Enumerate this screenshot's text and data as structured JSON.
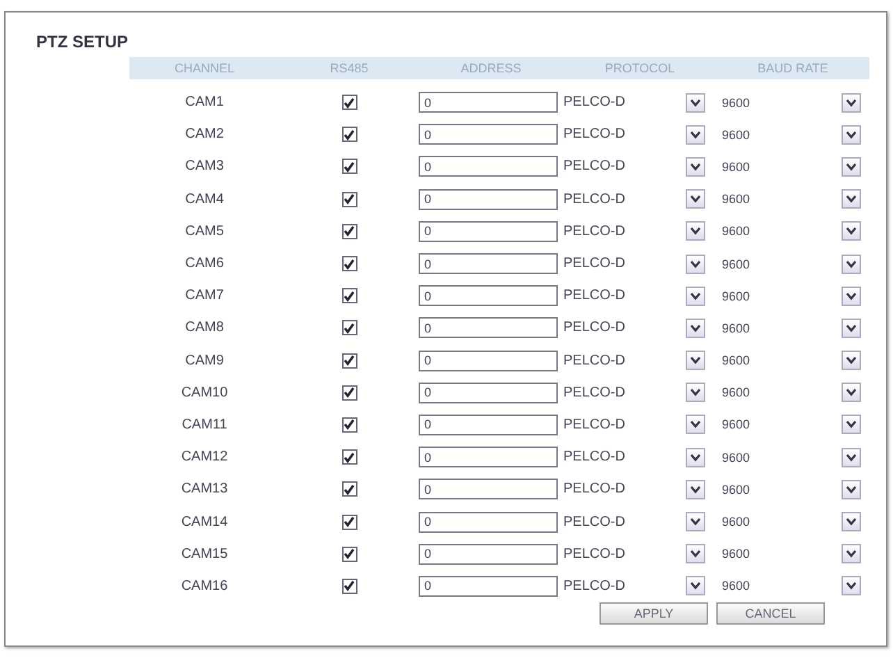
{
  "title": "PTZ SETUP",
  "columns": [
    "CHANNEL",
    "RS485",
    "ADDRESS",
    "PROTOCOL",
    "BAUD RATE"
  ],
  "rows": [
    {
      "channel": "CAM1",
      "rs485": true,
      "address": "0",
      "protocol": "PELCO-D",
      "baud_rate": "9600"
    },
    {
      "channel": "CAM2",
      "rs485": true,
      "address": "0",
      "protocol": "PELCO-D",
      "baud_rate": "9600"
    },
    {
      "channel": "CAM3",
      "rs485": true,
      "address": "0",
      "protocol": "PELCO-D",
      "baud_rate": "9600"
    },
    {
      "channel": "CAM4",
      "rs485": true,
      "address": "0",
      "protocol": "PELCO-D",
      "baud_rate": "9600"
    },
    {
      "channel": "CAM5",
      "rs485": true,
      "address": "0",
      "protocol": "PELCO-D",
      "baud_rate": "9600"
    },
    {
      "channel": "CAM6",
      "rs485": true,
      "address": "0",
      "protocol": "PELCO-D",
      "baud_rate": "9600"
    },
    {
      "channel": "CAM7",
      "rs485": true,
      "address": "0",
      "protocol": "PELCO-D",
      "baud_rate": "9600"
    },
    {
      "channel": "CAM8",
      "rs485": true,
      "address": "0",
      "protocol": "PELCO-D",
      "baud_rate": "9600"
    },
    {
      "channel": "CAM9",
      "rs485": true,
      "address": "0",
      "protocol": "PELCO-D",
      "baud_rate": "9600"
    },
    {
      "channel": "CAM10",
      "rs485": true,
      "address": "0",
      "protocol": "PELCO-D",
      "baud_rate": "9600"
    },
    {
      "channel": "CAM11",
      "rs485": true,
      "address": "0",
      "protocol": "PELCO-D",
      "baud_rate": "9600"
    },
    {
      "channel": "CAM12",
      "rs485": true,
      "address": "0",
      "protocol": "PELCO-D",
      "baud_rate": "9600"
    },
    {
      "channel": "CAM13",
      "rs485": true,
      "address": "0",
      "protocol": "PELCO-D",
      "baud_rate": "9600"
    },
    {
      "channel": "CAM14",
      "rs485": true,
      "address": "0",
      "protocol": "PELCO-D",
      "baud_rate": "9600"
    },
    {
      "channel": "CAM15",
      "rs485": true,
      "address": "0",
      "protocol": "PELCO-D",
      "baud_rate": "9600"
    },
    {
      "channel": "CAM16",
      "rs485": true,
      "address": "0",
      "protocol": "PELCO-D",
      "baud_rate": "9600"
    }
  ],
  "buttons": [
    "APPLY",
    "CANCEL"
  ]
}
